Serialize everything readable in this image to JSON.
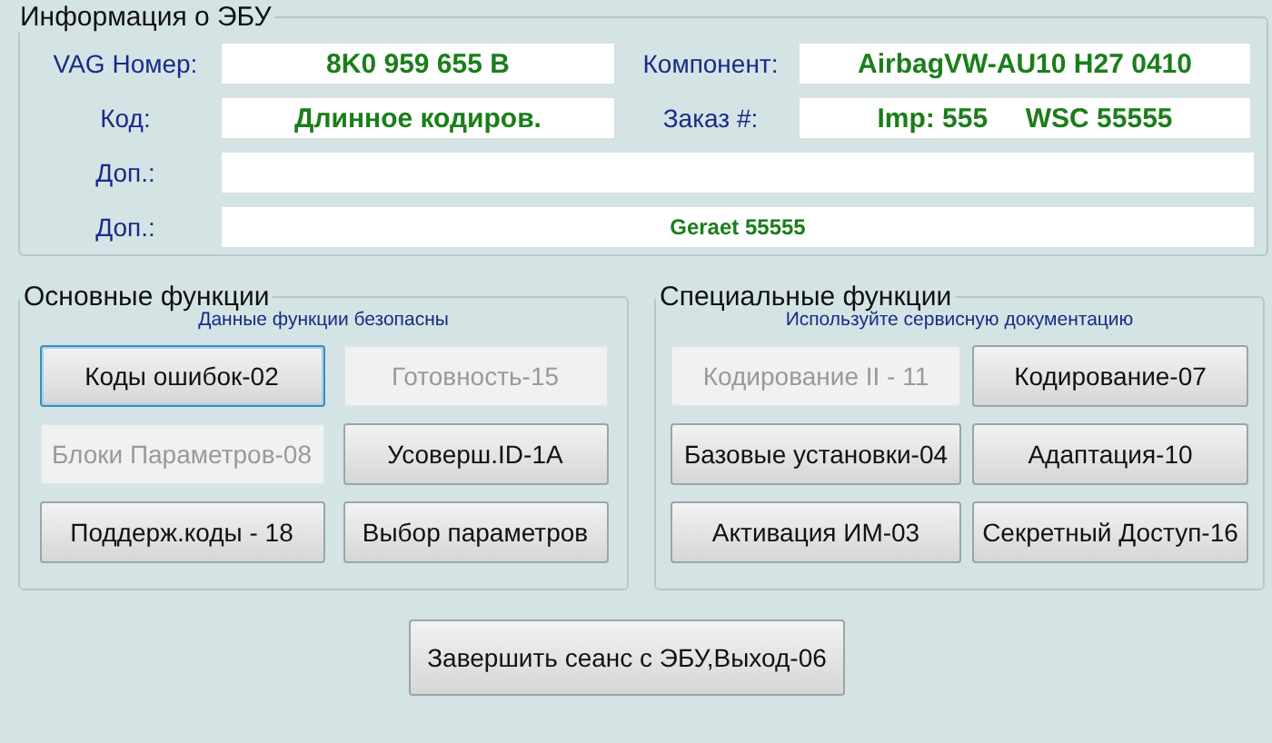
{
  "ecu_info": {
    "title": "Информация о ЭБУ",
    "rows": [
      {
        "fields": [
          {
            "label": "VAG Номер:",
            "value": "8K0 959 655 B"
          },
          {
            "label": "Компонент:",
            "value": "AirbagVW-AU10 H27 0410"
          }
        ]
      },
      {
        "fields": [
          {
            "label": "Код:",
            "value": "Длинное кодиров."
          },
          {
            "label": "Заказ #:",
            "value": "Imp: 555     WSC 55555"
          }
        ]
      },
      {
        "fields": [
          {
            "label": "Доп.:"
          }
        ]
      },
      {
        "fields": [
          {
            "label": "Доп.:",
            "value": "Geraet 55555",
            "small": true
          }
        ]
      }
    ]
  },
  "groups": [
    {
      "title": "Основные функции",
      "note": "Данные функции безопасны",
      "buttons": [
        {
          "label": "Коды ошибок-02",
          "disabled": false,
          "focused": true
        },
        {
          "label": "Готовность-15",
          "disabled": true,
          "focused": false
        },
        {
          "label": "Блоки Параметров-08",
          "disabled": true,
          "focused": false
        },
        {
          "label": "Усоверш.ID-1A",
          "disabled": false,
          "focused": false
        },
        {
          "label": "Поддерж.коды - 18",
          "disabled": false,
          "focused": false
        },
        {
          "label": "Выбор параметров",
          "disabled": false,
          "focused": false
        }
      ]
    },
    {
      "title": "Специальные функции",
      "note": "Используйте сервисную документацию",
      "buttons": [
        {
          "label": "Кодирование II - 11",
          "disabled": true,
          "focused": false
        },
        {
          "label": "Кодирование-07",
          "disabled": false,
          "focused": false
        },
        {
          "label": "Базовые установки-04",
          "disabled": false,
          "focused": false
        },
        {
          "label": "Адаптация-10",
          "disabled": false,
          "focused": false
        },
        {
          "label": "Активация ИМ-03",
          "disabled": false,
          "focused": false
        },
        {
          "label": "Секретный Доступ-16",
          "disabled": false,
          "focused": false
        }
      ]
    }
  ],
  "exit_button": {
    "label": "Завершить сеанс с ЭБУ,Выход-06"
  }
}
